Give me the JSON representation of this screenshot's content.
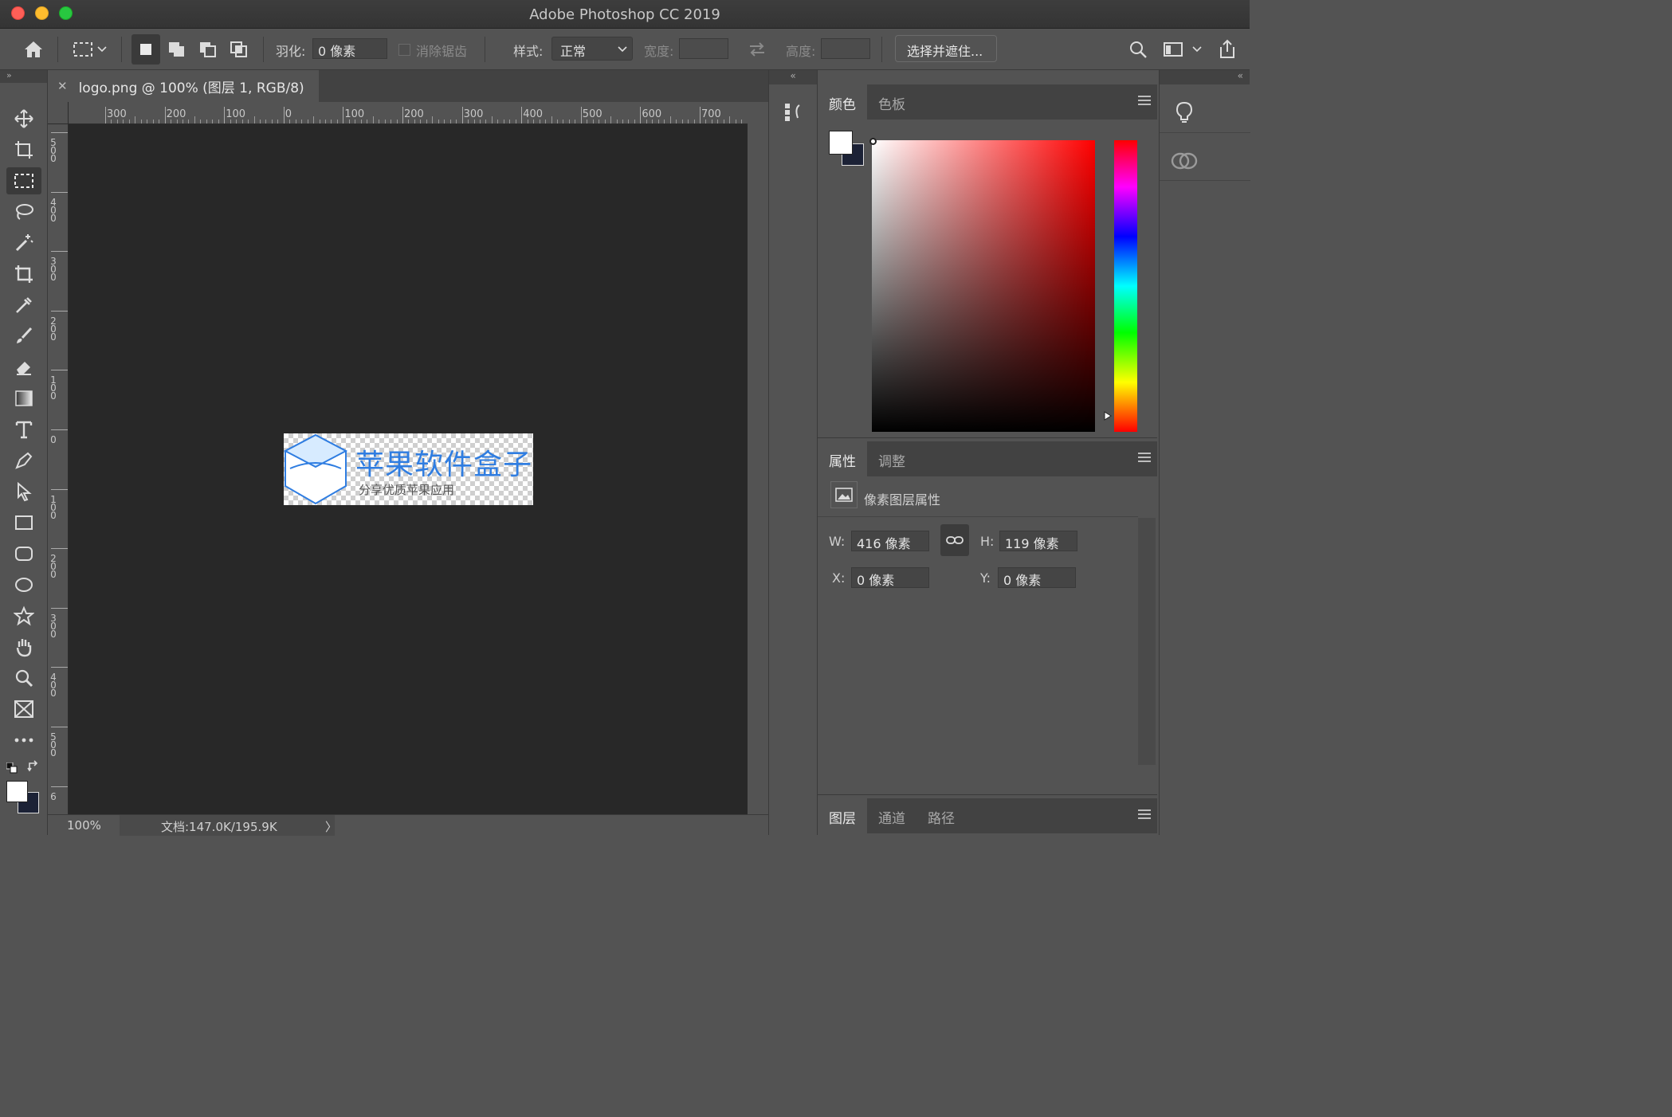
{
  "window": {
    "title": "Adobe Photoshop CC 2019"
  },
  "options_bar": {
    "feather_label": "羽化:",
    "feather_value": "0 像素",
    "antialias_label": "消除锯齿",
    "style_label": "样式:",
    "style_value": "正常",
    "width_label": "宽度:",
    "height_label": "高度:",
    "select_mask_label": "选择并遮住..."
  },
  "document": {
    "tab_title": "logo.png @ 100% (图层 1, RGB/8)",
    "ruler_top_labels": [
      "300",
      "200",
      "100",
      "0",
      "100",
      "200",
      "300",
      "400",
      "500",
      "600",
      "700"
    ],
    "ruler_left_labels": [
      "500",
      "400",
      "300",
      "200",
      "100",
      "0",
      "100",
      "200",
      "300",
      "400",
      "500",
      "6"
    ],
    "logo_title": "苹果软件盒子",
    "logo_subtitle": "分享优质苹果应用"
  },
  "status_bar": {
    "zoom": "100%",
    "doc_info": "文档:147.0K/195.9K",
    "arrow": "〉"
  },
  "color_panel": {
    "tabs": [
      "颜色",
      "色板"
    ],
    "foreground_color": "#ffffff",
    "background_color": "#1c2236"
  },
  "properties_panel": {
    "tabs": [
      "属性",
      "调整"
    ],
    "layer_type_label": "像素图层属性",
    "w_label": "W:",
    "w_value": "416 像素",
    "h_label": "H:",
    "h_value": "119 像素",
    "x_label": "X:",
    "x_value": "0 像素",
    "y_label": "Y:",
    "y_value": "0 像素"
  },
  "layers_panel": {
    "tabs": [
      "图层",
      "通道",
      "路径"
    ]
  },
  "dock_collapse": {
    "left": "»",
    "right": "«"
  },
  "colors": {
    "accent_logo": "#2f7de1",
    "ui_bg": "#535353",
    "canvas_bg": "#282828"
  }
}
